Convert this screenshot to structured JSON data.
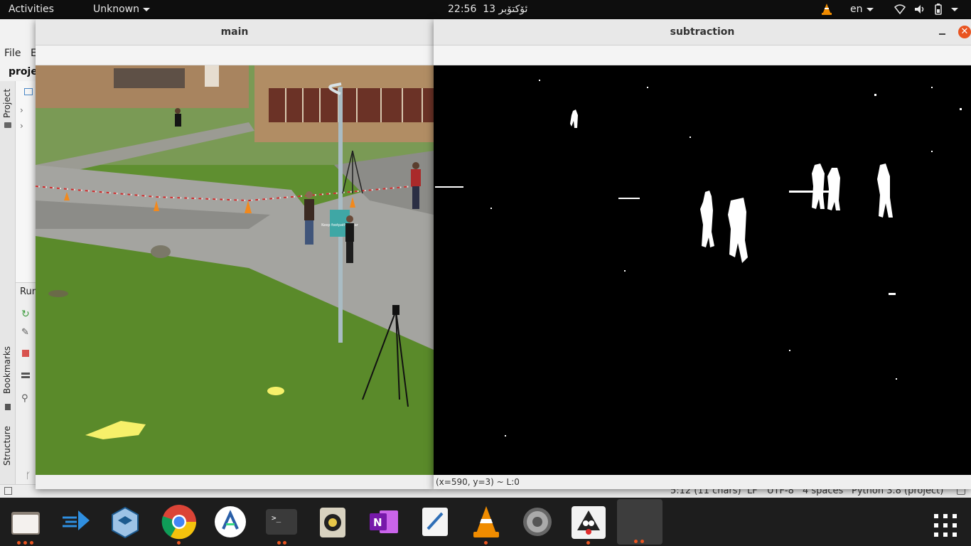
{
  "topbar": {
    "activities": "Activities",
    "app_menu": "Unknown",
    "clock": "22:56",
    "date": "13 ئۆكتۆبر",
    "language": "en"
  },
  "ide": {
    "menu_file": "File",
    "menu_edit": "E",
    "project_label": "proje",
    "tool_project": "Project",
    "tool_run": "Run",
    "tool_bookmarks": "Bookmarks",
    "tool_structure": "Structure",
    "status": {
      "position": "5:12 (11 chars)",
      "line_sep": "LF",
      "encoding": "UTF-8",
      "indent": "4 spaces",
      "interpreter": "Python 3.8 (project)"
    }
  },
  "windows": {
    "main": {
      "title": "main"
    },
    "subtraction": {
      "title": "subtraction",
      "status": "(x=590, y=3) ~ L:0"
    }
  },
  "scene": {
    "sign_text": "Keep footpaths clear"
  },
  "dock": {
    "items": [
      {
        "name": "files",
        "icon": "folder-icon",
        "running": true
      },
      {
        "name": "vscode",
        "icon": "vscode-icon",
        "running": false
      },
      {
        "name": "virtualbox",
        "icon": "virtualbox-icon",
        "running": false
      },
      {
        "name": "chrome",
        "icon": "chrome-icon",
        "running": true
      },
      {
        "name": "android-studio",
        "icon": "android-studio-icon",
        "running": false
      },
      {
        "name": "terminal",
        "icon": "terminal-icon",
        "running": true
      },
      {
        "name": "rhythmbox",
        "icon": "rhythmbox-icon",
        "running": false
      },
      {
        "name": "onenote",
        "icon": "onenote-icon",
        "running": false
      },
      {
        "name": "text-editor",
        "icon": "text-editor-icon",
        "running": false
      },
      {
        "name": "vlc",
        "icon": "vlc-icon",
        "running": true
      },
      {
        "name": "settings",
        "icon": "settings-icon",
        "running": false
      },
      {
        "name": "java",
        "icon": "java-icon",
        "running": true
      },
      {
        "name": "active-window",
        "icon": "window-icon",
        "running": true
      }
    ],
    "show_apps_icon": "grid-icon"
  },
  "colors": {
    "accent": "#e95420",
    "topbar": "#0e0e0e",
    "dock": "#1d1d1d"
  }
}
